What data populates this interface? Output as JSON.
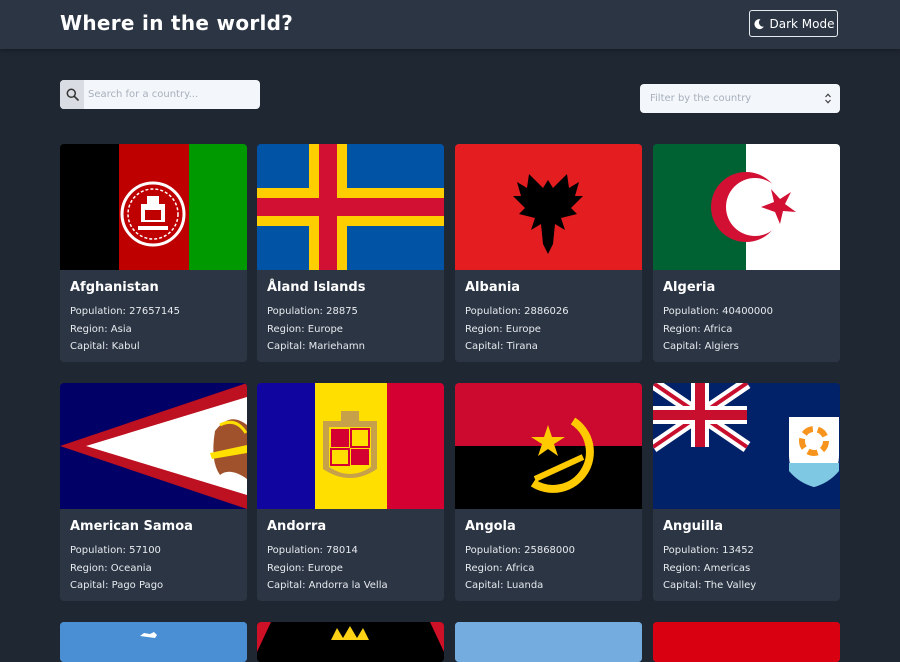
{
  "header": {
    "title": "Where in the world?",
    "mode_label": "Dark Mode"
  },
  "search": {
    "placeholder": "Search for a country..."
  },
  "filter": {
    "placeholder": "Filter by the country"
  },
  "labels": {
    "population": "Population:",
    "region": "Region:",
    "capital": "Capital:"
  },
  "countries": [
    {
      "name": "Afghanistan",
      "population": "27657145",
      "region": "Asia",
      "capital": "Kabul",
      "flag": "afghanistan"
    },
    {
      "name": "Åland Islands",
      "population": "28875",
      "region": "Europe",
      "capital": "Mariehamn",
      "flag": "aland"
    },
    {
      "name": "Albania",
      "population": "2886026",
      "region": "Europe",
      "capital": "Tirana",
      "flag": "albania"
    },
    {
      "name": "Algeria",
      "population": "40400000",
      "region": "Africa",
      "capital": "Algiers",
      "flag": "algeria"
    },
    {
      "name": "American Samoa",
      "population": "57100",
      "region": "Oceania",
      "capital": "Pago Pago",
      "flag": "american-samoa"
    },
    {
      "name": "Andorra",
      "population": "78014",
      "region": "Europe",
      "capital": "Andorra la Vella",
      "flag": "andorra"
    },
    {
      "name": "Angola",
      "population": "25868000",
      "region": "Africa",
      "capital": "Luanda",
      "flag": "angola"
    },
    {
      "name": "Anguilla",
      "population": "13452",
      "region": "Americas",
      "capital": "The Valley",
      "flag": "anguilla"
    }
  ],
  "colors": {
    "background": "#1f2733",
    "surface": "#2b3544",
    "input": "#f3f6fa"
  }
}
